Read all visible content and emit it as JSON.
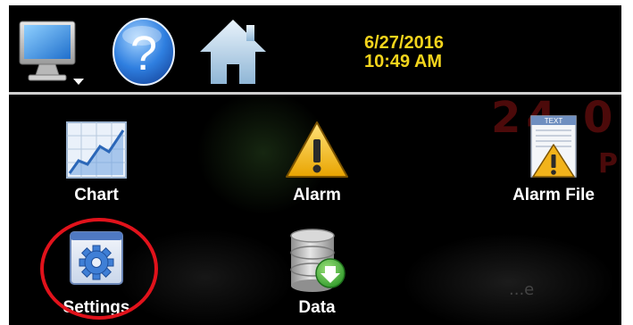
{
  "header": {
    "date": "6/27/2016",
    "time": "10:49 AM",
    "buttons": [
      {
        "name": "monitor",
        "icon": "monitor-icon"
      },
      {
        "name": "help",
        "icon": "question-icon"
      },
      {
        "name": "home",
        "icon": "home-icon"
      }
    ]
  },
  "menu": {
    "chart_label": "Chart",
    "alarm_label": "Alarm",
    "alarm_file_label": "Alarm File",
    "settings_label": "Settings",
    "data_label": "Data"
  },
  "alarm_file_icon_text": "TEXT",
  "background": {
    "partial_number": "24.0",
    "partial_letter": "P",
    "partial_text": "...e"
  },
  "colors": {
    "datetime": "#f3d41c",
    "highlight": "#e1121b",
    "separator": "#cfcfcf"
  }
}
